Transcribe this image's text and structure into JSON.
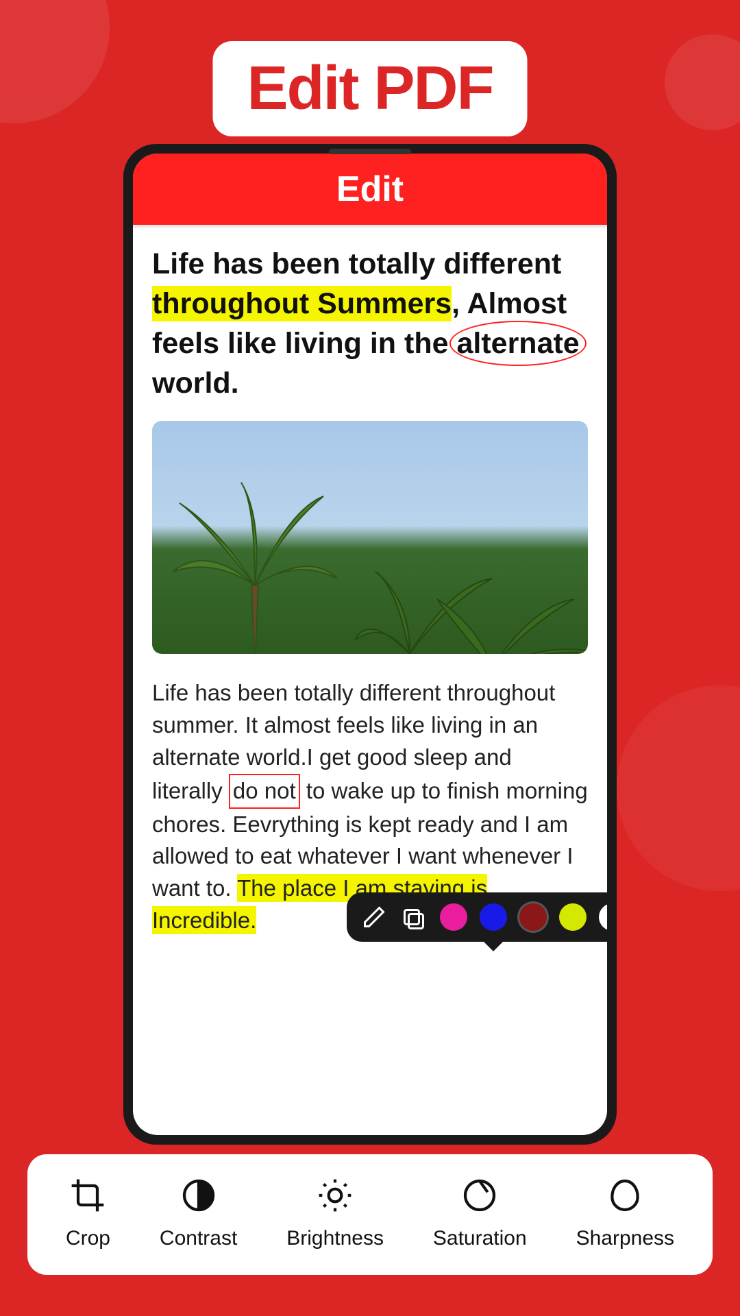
{
  "hero": {
    "title": "Edit PDF"
  },
  "app": {
    "header_title": "Edit"
  },
  "document": {
    "heading_part1": "Life has been totally different ",
    "heading_highlight": "throughout Summers",
    "heading_part2": ", Almost feels like living in the ",
    "heading_circled": "alternate",
    "heading_part3": " world.",
    "para_part1": "Life has been totally different throughout summer.  It almost feels like living in an alternate world.I get good sleep and literally ",
    "para_boxed": "do not",
    "para_part2": " to wake up to finish ",
    "para_underlined": "morning chores",
    "para_part3": ". Eevrything is kept ready and I am allowed to eat whatever I want whenever I want to. ",
    "para_highlight": "The place I am staying is Incredible."
  },
  "color_toolbar": {
    "swatches": [
      {
        "color": "#e91e9e",
        "selected": false
      },
      {
        "color": "#1a1ae8",
        "selected": false
      },
      {
        "color": "#8b1818",
        "selected": true
      },
      {
        "color": "#d4e800",
        "selected": false
      },
      {
        "color": "#ffffff",
        "selected": false
      }
    ]
  },
  "tools": [
    {
      "id": "crop",
      "label": "Crop"
    },
    {
      "id": "contrast",
      "label": "Contrast"
    },
    {
      "id": "brightness",
      "label": "Brightness"
    },
    {
      "id": "saturation",
      "label": "Saturation"
    },
    {
      "id": "sharpness",
      "label": "Sharpness"
    }
  ]
}
